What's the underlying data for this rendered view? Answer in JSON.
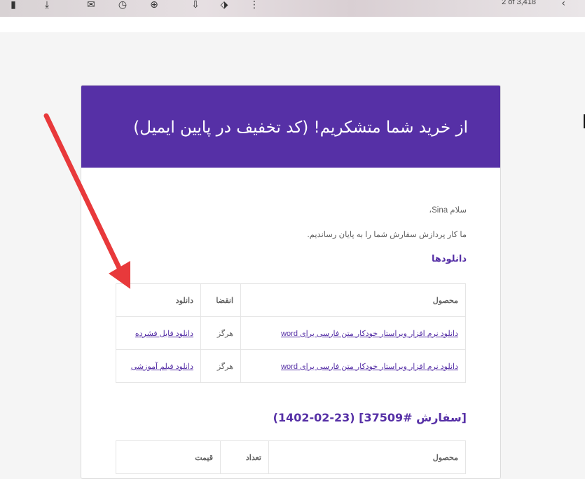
{
  "toolbar": {
    "icons": [
      "trash-icon",
      "download-icon",
      "mark-icon",
      "clock-icon",
      "add-task-icon",
      "move-icon",
      "label-icon",
      "more-icon"
    ],
    "counter": "2 of 3,418",
    "prev_icon": "chevron-left-icon"
  },
  "email": {
    "banner_title": "از خرید شما متشکریم! (کد تخفیف در پایین ایمیل)",
    "greeting": "سلام Sina،",
    "intro": "ما کار پردازش سفارش شما را به پایان رساندیم.",
    "downloads_heading": "دانلودها",
    "downloads_table": {
      "headers": [
        "محصول",
        "انقضا",
        "دانلود"
      ],
      "rows": [
        {
          "product": "دانلود نرم افزار ویراستار خودکار متن فارسی برای word",
          "expires": "هرگز",
          "download": "دانلود فایل فشرده"
        },
        {
          "product": "دانلود نرم افزار ویراستار خودکار متن فارسی برای word",
          "expires": "هرگز",
          "download": "دانلود فیلم آموزشی"
        }
      ]
    },
    "order_heading": "[سفارش #37509] (23-02-1402)",
    "order_table": {
      "headers": [
        "محصول",
        "تعداد",
        "قیمت"
      ]
    }
  },
  "colors": {
    "brand_purple": "#5630a6",
    "annotation_red": "#e8393b"
  }
}
